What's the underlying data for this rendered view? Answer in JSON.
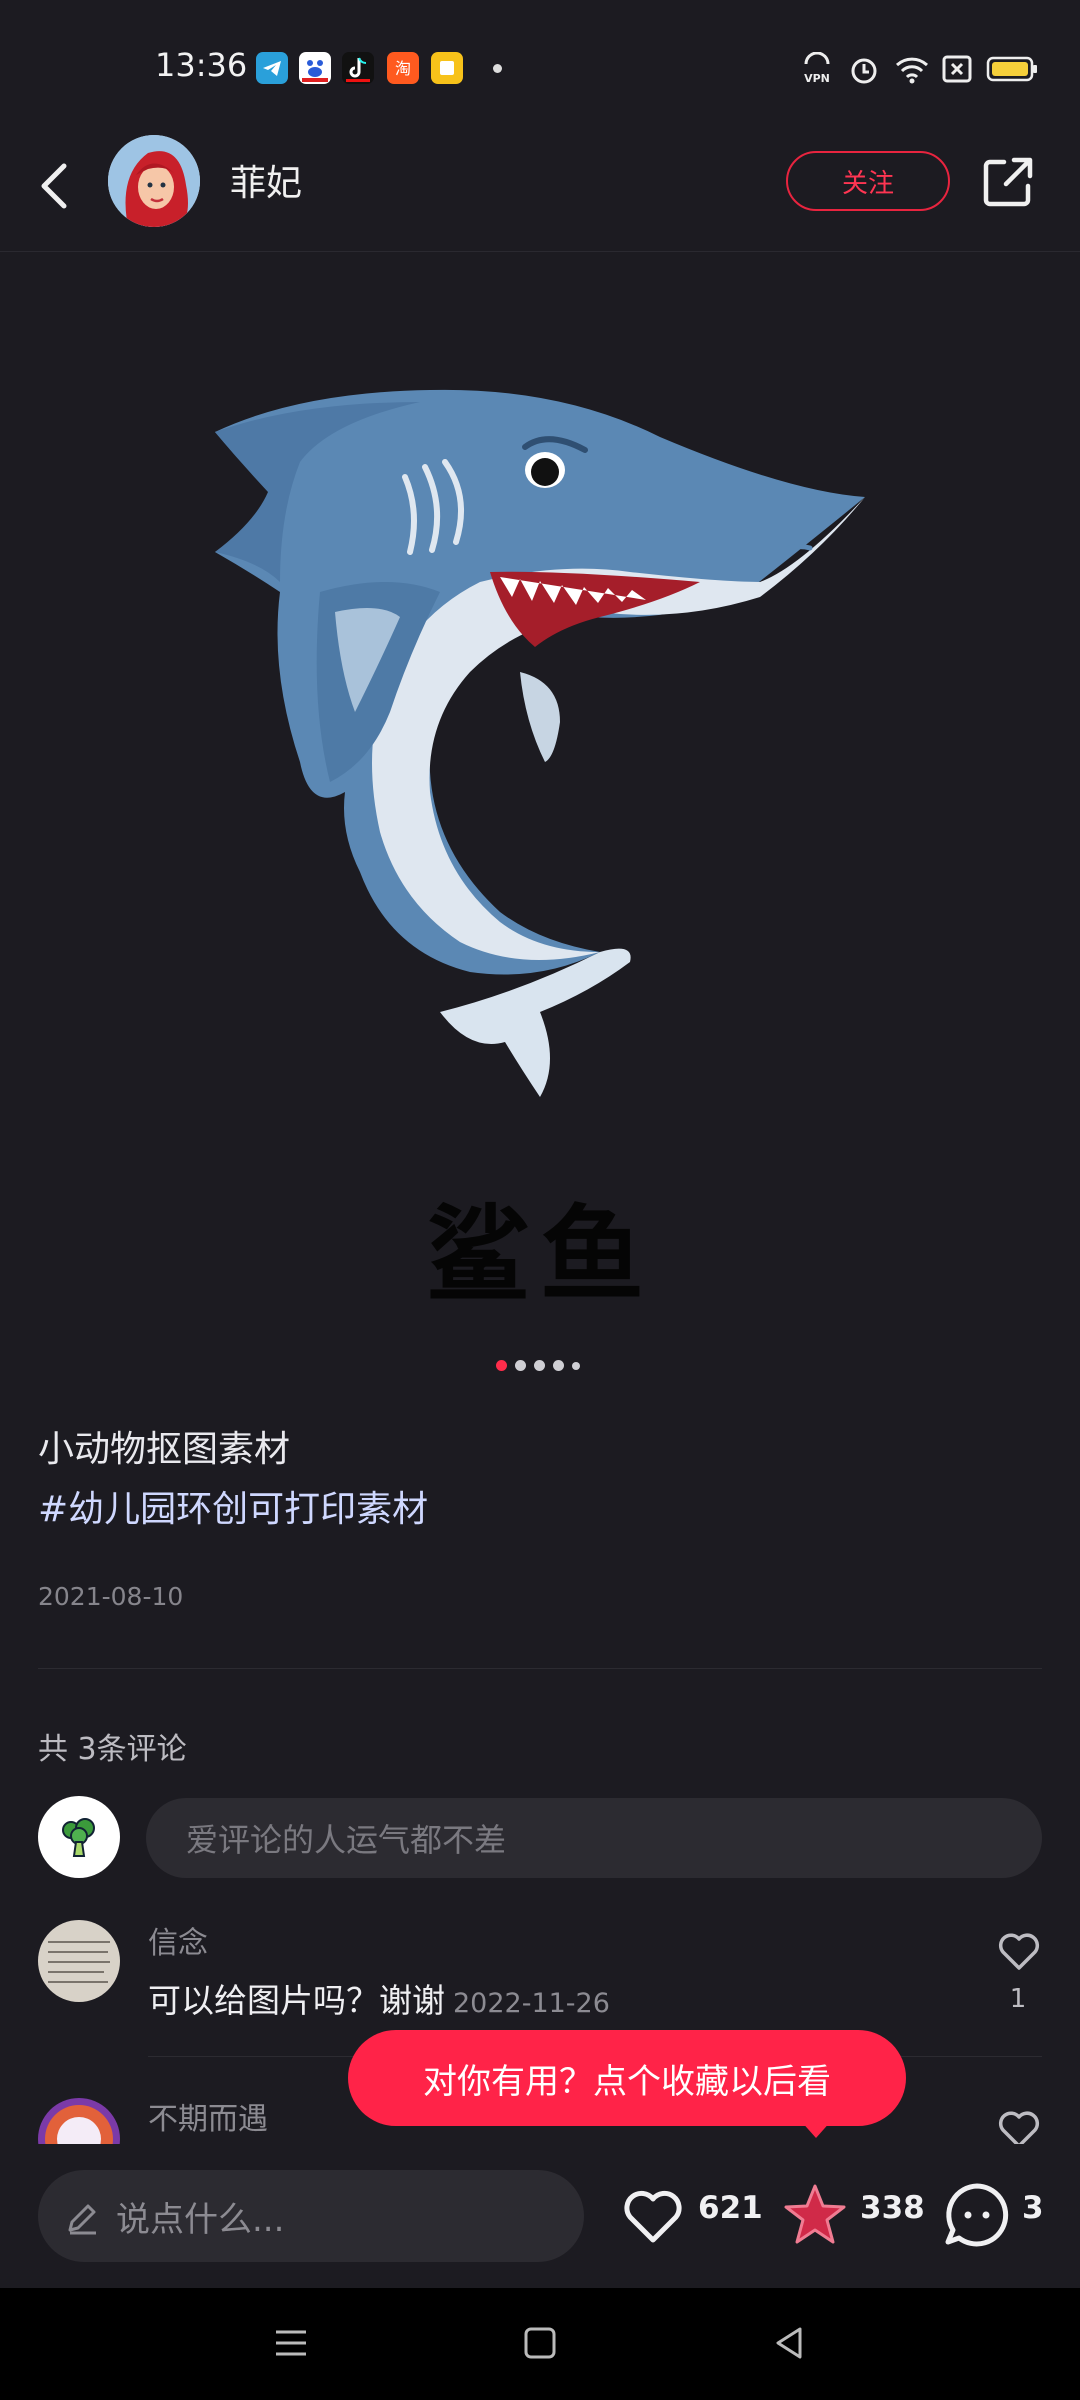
{
  "status_bar": {
    "time": "13:36",
    "icons": [
      "telegram-icon",
      "baidu-icon",
      "tiktok-icon",
      "taobao-icon",
      "notes-icon",
      "vpn-icon",
      "alarm-icon",
      "wifi-icon",
      "sim-icon",
      "battery-icon"
    ]
  },
  "header": {
    "author_name": "菲妃",
    "follow_label": "关注"
  },
  "post": {
    "image_title": "鲨鱼",
    "page_count": 5,
    "active_page": 1,
    "desc_line1": "小动物抠图素材",
    "desc_tag": "#幼儿园环创可打印素材",
    "date": "2021-08-10"
  },
  "comments": {
    "count_label": "共 3条评论",
    "input_placeholder": "爱评论的人运气都不差",
    "items": [
      {
        "user": "信念",
        "text": "可以给图片吗？谢谢",
        "date": "2022-11-26",
        "likes": "1"
      },
      {
        "user": "不期而遇",
        "text": "",
        "date": "",
        "likes": ""
      }
    ]
  },
  "toast": {
    "text": "对你有用？点个收藏以后看"
  },
  "action_bar": {
    "say_placeholder": "说点什么...",
    "likes": "621",
    "favorites": "338",
    "comments": "3"
  },
  "colors": {
    "background": "#1c1b21",
    "accent": "#ff2348",
    "shark_blue": "#5a87b3"
  }
}
